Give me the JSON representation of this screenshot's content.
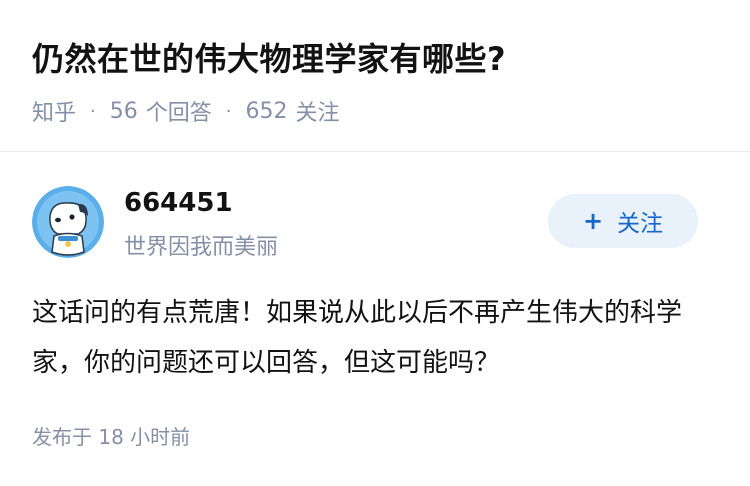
{
  "question": {
    "title": "仍然在世的伟大物理学家有哪些?",
    "source": "知乎",
    "answer_count": "56",
    "answer_label": "个回答",
    "follow_count": "652",
    "follow_label": "关注",
    "separator": "·"
  },
  "answer": {
    "author": {
      "name": "664451",
      "bio": "世界因我而美丽",
      "avatar_icon": "cartoon-dog-avatar-icon"
    },
    "follow_button": {
      "icon": "+",
      "label": "关注"
    },
    "content": "这话问的有点荒唐！如果说从此以后不再产生伟大的科学家，你的问题还可以回答，但这可能吗？",
    "posted": "发布于 18 小时前"
  },
  "colors": {
    "accent": "#1766c9",
    "button_bg": "#e9f1fb",
    "muted": "#8590a6",
    "text": "#121212",
    "avatar_blue": "#5aaee9"
  }
}
